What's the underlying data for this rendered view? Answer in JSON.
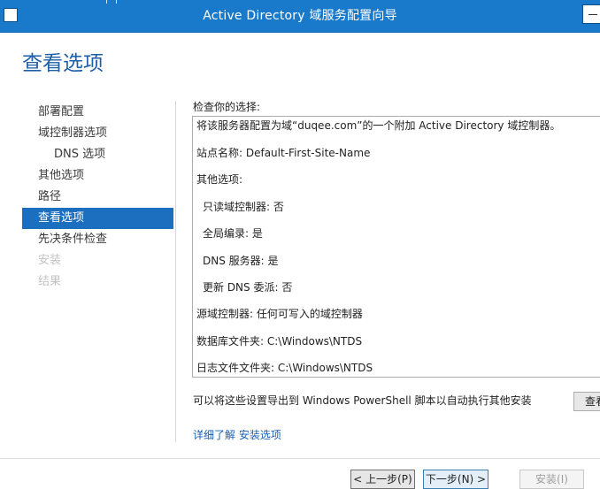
{
  "window": {
    "title": "Active Directory 域服务配置向导"
  },
  "page": {
    "heading": "查看选项"
  },
  "nav": {
    "items": [
      {
        "label": "部署配置",
        "state": "normal",
        "level": 1
      },
      {
        "label": "域控制器选项",
        "state": "normal",
        "level": 1
      },
      {
        "label": "DNS 选项",
        "state": "normal",
        "level": 2
      },
      {
        "label": "其他选项",
        "state": "normal",
        "level": 1
      },
      {
        "label": "路径",
        "state": "normal",
        "level": 1
      },
      {
        "label": "查看选项",
        "state": "active",
        "level": 1
      },
      {
        "label": "先决条件检查",
        "state": "normal",
        "level": 1
      },
      {
        "label": "安装",
        "state": "disabled",
        "level": 1
      },
      {
        "label": "结果",
        "state": "disabled",
        "level": 1
      }
    ]
  },
  "review": {
    "label": "检查你的选择:",
    "lines": [
      "将该服务器配置为域“duqee.com”的一个附加 Active Directory 域控制器。",
      "站点名称: Default-First-Site-Name",
      "其他选项:",
      "只读域控制器: 否",
      "全局编录: 是",
      "DNS 服务器: 是",
      "更新 DNS 委派: 否",
      "源域控制器: 任何可写入的域控制器",
      "数据库文件夹: C:\\Windows\\NTDS",
      "日志文件文件夹: C:\\Windows\\NTDS"
    ]
  },
  "export": {
    "text": "可以将这些设置导出到 Windows PowerShell 脚本以自动执行其他安装",
    "button_label": "查看脚本"
  },
  "more_link": "详细了解 安装选项",
  "footer": {
    "prev_label": "< 上一步(P)",
    "next_label": "下一步(N) >",
    "install_label": "安装(I)"
  },
  "colors": {
    "titlebar": "#1979ca",
    "heading": "#1f5ea8",
    "nav_active": "#1c6fbf",
    "link": "#1a5fb4"
  },
  "icons": {
    "window_system": "window-system-icon",
    "window_control": "window-control-icon"
  }
}
